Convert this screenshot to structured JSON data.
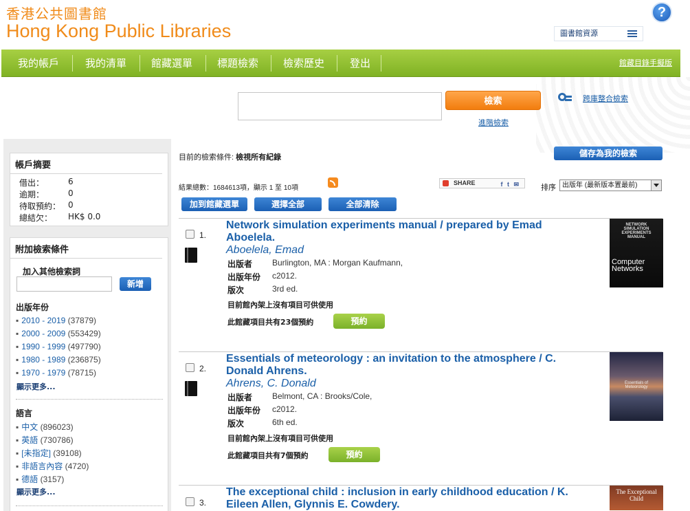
{
  "header": {
    "logo_zh": "香港公共圖書館",
    "logo_en": "Hong Kong Public Libraries",
    "help": "?",
    "library_resources": "圖書館資源"
  },
  "nav": {
    "items": [
      "我的帳戶",
      "我的清單",
      "館藏選單",
      "標題檢索",
      "檢索歷史",
      "登出"
    ],
    "manual": "館藏目錄手擬版"
  },
  "search": {
    "value": "",
    "button": "檢索",
    "advanced": "進階檢索",
    "federated": "跨庫整合檢索"
  },
  "account": {
    "title": "帳戶摘要",
    "rows": [
      {
        "label": "借出：",
        "value": "6"
      },
      {
        "label": "逾期：",
        "value": "0"
      },
      {
        "label": "待取預約：",
        "value": "0"
      },
      {
        "label": "總結欠：",
        "value": "HK$ 0.0"
      }
    ]
  },
  "refine": {
    "title": "附加檢索條件",
    "add_term_label": "加入其他檢索詞",
    "add_button": "新增",
    "pub_year": {
      "heading": "出版年份",
      "items": [
        {
          "label": "2010 - 2019",
          "count": "(37879)"
        },
        {
          "label": "2000 - 2009",
          "count": "(553429)"
        },
        {
          "label": "1990 - 1999",
          "count": "(497790)"
        },
        {
          "label": "1980 - 1989",
          "count": "(236875)"
        },
        {
          "label": "1970 - 1979",
          "count": "(78715)"
        }
      ],
      "more": "顯示更多..."
    },
    "language": {
      "heading": "語言",
      "items": [
        {
          "label": "中文",
          "count": "(896023)"
        },
        {
          "label": "英語",
          "count": "(730786)"
        },
        {
          "label": "[未指定]",
          "count": "(39108)"
        },
        {
          "label": "非語言內容",
          "count": "(4720)"
        },
        {
          "label": "德語",
          "count": "(3157)"
        }
      ],
      "more": "顯示更多..."
    }
  },
  "results": {
    "criteria_label": "目前的檢索條件:",
    "criteria_value": "檢視所有紀錄",
    "save_button": "儲存為我的檢索",
    "total": "結果總數：1684613項，顯示 1 至 10項",
    "share": "SHARE",
    "sort_label": "排序",
    "sort_value": "出版年 (最新版本置最前)",
    "add_to_list": "加到館藏選單",
    "select_all": "選擇全部",
    "clear_all": "全部清除",
    "field_labels": {
      "publisher": "出版者",
      "year": "出版年份",
      "edition": "版次"
    },
    "records": [
      {
        "num": "1.",
        "title": "Network simulation experiments manual / prepared by Emad Aboelela.",
        "author": "Aboelela, Emad",
        "publisher": "Burlington, MA : Morgan Kaufmann,",
        "year": "c2012.",
        "edition": "3rd ed.",
        "availability": "目前館內架上沒有項目可供使用",
        "holds": "此館藏項目共有23個預約",
        "reserve": "預約",
        "cover_title": "NETWORK SIMULATION EXPERIMENTS MANUAL",
        "cover_sub": "Computer Networks"
      },
      {
        "num": "2.",
        "title": "Essentials of meteorology : an invitation to the atmosphere / C. Donald Ahrens.",
        "author": "Ahrens, C. Donald",
        "publisher": "Belmont, CA : Brooks/Cole,",
        "year": "c2012.",
        "edition": "6th ed.",
        "availability": "目前館內架上沒有項目可供使用",
        "holds": "此館藏項目共有7個預約",
        "reserve": "預約",
        "cover_title": "Essentials of Meteorology"
      },
      {
        "num": "3.",
        "title": "The exceptional child : inclusion in early childhood education / K. Eileen Allen, Glynnis E. Cowdery.",
        "cover_title": "The Exceptional Child"
      }
    ]
  }
}
